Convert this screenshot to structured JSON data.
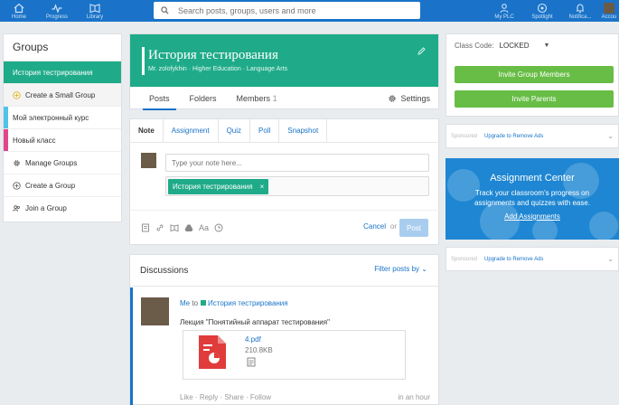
{
  "topnav": {
    "left": [
      {
        "label": "Home",
        "icon": "home-icon"
      },
      {
        "label": "Progress",
        "icon": "progress-icon"
      },
      {
        "label": "Library",
        "icon": "library-icon"
      }
    ],
    "search_placeholder": "Search posts, groups, users and more",
    "right": [
      {
        "label": "My PLC",
        "icon": "plc-icon"
      },
      {
        "label": "Spotlight",
        "icon": "spotlight-icon"
      },
      {
        "label": "Notifica...",
        "icon": "bell-icon"
      },
      {
        "label": "Accou",
        "icon": "account-avatar"
      }
    ]
  },
  "sidebar": {
    "title": "Groups",
    "groups": [
      {
        "label": "История тестрирования",
        "active": true
      },
      {
        "label": "Create a Small Group"
      },
      {
        "label": "Мой электронный курс",
        "color": "#4fc3e8"
      },
      {
        "label": "Новый класс",
        "color": "#e0468c"
      }
    ],
    "actions": [
      {
        "label": "Manage Groups"
      },
      {
        "label": "Create a Group"
      },
      {
        "label": "Join a Group"
      }
    ]
  },
  "group": {
    "title": "История тестирования",
    "subtitle": "Mr. zolofykhin · Higher Education · Language Arts",
    "tabs": {
      "posts": "Posts",
      "folders": "Folders",
      "members": "Members",
      "members_count": "1"
    },
    "settings_label": "Settings"
  },
  "composer": {
    "tabs": [
      "Note",
      "Assignment",
      "Quiz",
      "Poll",
      "Snapshot"
    ],
    "note_placeholder": "Type your note here...",
    "recipient_chip": "История тестрирования",
    "chip_close": "×",
    "format_label": "Aa",
    "cancel_label": "Cancel",
    "or_label": "or",
    "post_label": "Post"
  },
  "discussions": {
    "title": "Discussions",
    "filter_label": "Filter posts by",
    "post": {
      "sender": "Me",
      "to_label": "to",
      "group": "История тестрирования",
      "text": "Лекция \"Понятийный аппарат тестирования\"",
      "attachment": {
        "name": "4.pdf",
        "size": "210.8KB"
      },
      "actions": [
        "Like",
        "Reply",
        "Share",
        "Follow"
      ],
      "separator": "·",
      "time": "in an hour"
    }
  },
  "right": {
    "class_code_label": "Class Code:",
    "class_code_value": "LOCKED",
    "invite_members": "Invite Group Members",
    "invite_parents": "Invite Parents",
    "sponsored_label": "Sponsored",
    "upgrade_label": "Upgrade to Remove Ads",
    "assignment_center": {
      "title": "Assignment Center",
      "description": "Track your classroom's progress on assignments and quizzes with ease.",
      "link": "Add Assignments"
    }
  },
  "colors": {
    "brand_blue": "#1a73c8",
    "group_green": "#1fab89",
    "invite_green": "#67bd45"
  }
}
